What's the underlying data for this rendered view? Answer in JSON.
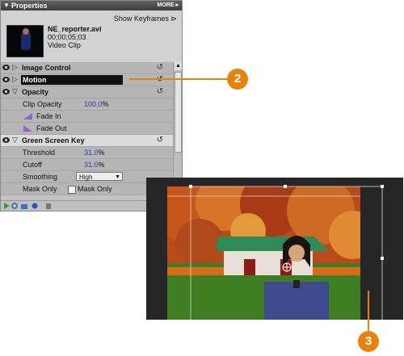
{
  "panel": {
    "title": "Properties",
    "more_label": "MORE",
    "show_keyframes": "Show Keyframes",
    "clip": {
      "name": "NE_reporter.avi",
      "timecode": "00;00;05;03",
      "type": "Video Clip"
    }
  },
  "effects": {
    "image_control": "Image Control",
    "motion": "Motion",
    "opacity": "Opacity",
    "clip_opacity_label": "Clip Opacity",
    "clip_opacity_value": "100.0",
    "percent": "%",
    "fade_in": "Fade In",
    "fade_out": "Fade Out",
    "green_screen_key": "Green Screen Key",
    "threshold_label": "Threshold",
    "threshold_value": "31.0",
    "cutoff_label": "Cutoff",
    "cutoff_value": "31.0",
    "smoothing_label": "Smoothing",
    "smoothing_value": "High",
    "mask_only_label": "Mask Only",
    "mask_only_checkbox_label": "Mask Only"
  },
  "callouts": {
    "first": "2",
    "second": "3"
  },
  "colors": {
    "accent": "#e8820f",
    "value_blue": "#2b3fa0",
    "selected_row": "#111111"
  }
}
